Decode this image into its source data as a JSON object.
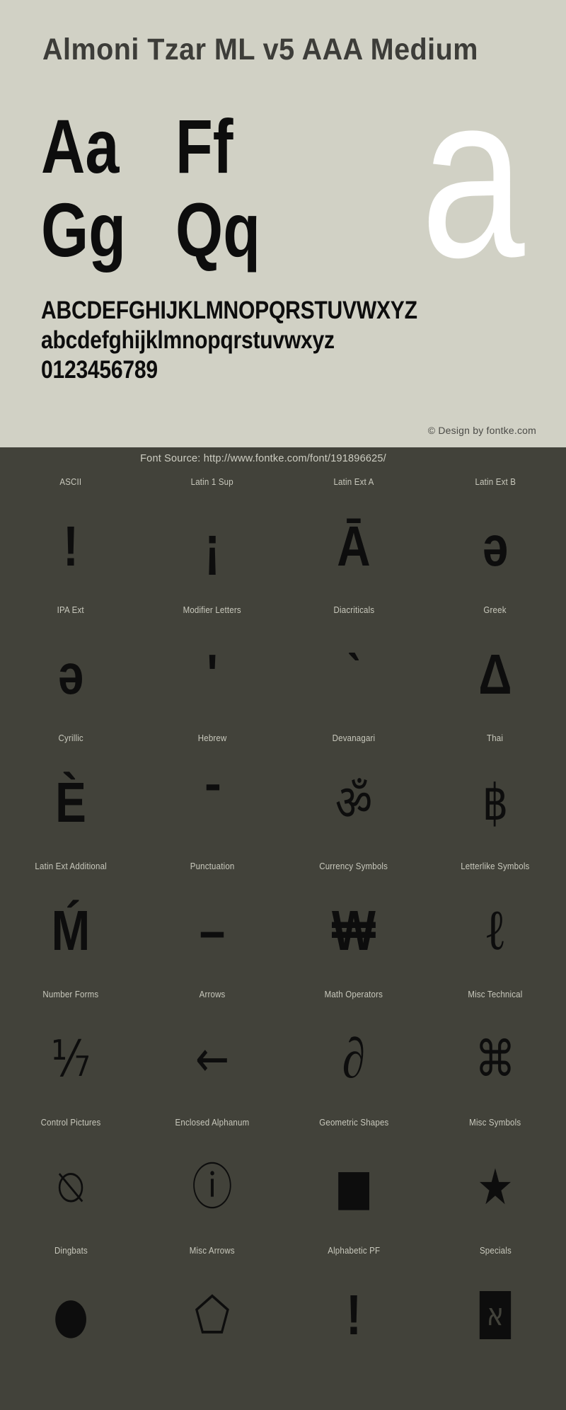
{
  "specimen": {
    "title": "Almoni Tzar ML v5 AAA Medium",
    "watermark_glyph": "a",
    "pairs": [
      [
        "Aa",
        "Ff"
      ],
      [
        "Gg",
        "Qq"
      ]
    ],
    "uppercase": "ABCDEFGHIJKLMNOPQRSTUVWXYZ",
    "lowercase": "abcdefghijklmnopqrstuvwxyz",
    "digits": "0123456789",
    "credit": "© Design by fontke.com"
  },
  "source_bar": {
    "text": "Font Source: http://www.fontke.com/font/191896625/"
  },
  "colors": {
    "specimen_bg": "#d1d1c5",
    "blocks_bg": "#42423a",
    "glyph_black": "#0d0d0d",
    "label_gray": "#c9c9bd",
    "title_gray": "#3d3d39",
    "watermark_white": "#ffffff"
  },
  "unicode_blocks": [
    [
      {
        "label": "ASCII",
        "glyph": "!",
        "style": ""
      },
      {
        "label": "Latin 1 Sup",
        "glyph": "¡",
        "style": ""
      },
      {
        "label": "Latin Ext A",
        "glyph": "Ā",
        "style": ""
      },
      {
        "label": "Latin Ext B",
        "glyph": "ə",
        "style": ""
      }
    ],
    [
      {
        "label": "IPA Ext",
        "glyph": "ə",
        "style": ""
      },
      {
        "label": "Modifier Letters",
        "glyph": "ʹ",
        "style": ""
      },
      {
        "label": "Diacriticals",
        "glyph": "ˋ",
        "style": ""
      },
      {
        "label": "Greek",
        "glyph": "Δ",
        "style": ""
      }
    ],
    [
      {
        "label": "Cyrillic",
        "glyph": "Ѐ",
        "style": ""
      },
      {
        "label": "Hebrew",
        "glyph": "־",
        "style": ""
      },
      {
        "label": "Devanagari",
        "glyph": "ॐ",
        "style": "symbolic"
      },
      {
        "label": "Thai",
        "glyph": "฿",
        "style": "symbolic"
      }
    ],
    [
      {
        "label": "Latin Ext Additional",
        "glyph": "Ḿ",
        "style": ""
      },
      {
        "label": "Punctuation",
        "glyph": "–",
        "style": ""
      },
      {
        "label": "Currency Symbols",
        "glyph": "₩",
        "style": ""
      },
      {
        "label": "Letterlike Symbols",
        "glyph": "ℓ",
        "style": "serifish"
      }
    ],
    [
      {
        "label": "Number Forms",
        "glyph": "⅐",
        "style": "symbolic"
      },
      {
        "label": "Arrows",
        "glyph": "←",
        "style": "symbolic"
      },
      {
        "label": "Math Operators",
        "glyph": "∂",
        "style": "serifish"
      },
      {
        "label": "Misc Technical",
        "glyph": "⌘",
        "style": "symbolic"
      }
    ],
    [
      {
        "label": "Control Pictures",
        "glyph": "⍉",
        "style": "symbolic"
      },
      {
        "label": "Enclosed Alphanum",
        "glyph": "ⓘ",
        "style": "symbolic"
      },
      {
        "label": "Geometric Shapes",
        "glyph": "■",
        "style": "symbolic"
      },
      {
        "label": "Misc Symbols",
        "glyph": "★",
        "style": "symbolic"
      }
    ],
    [
      {
        "label": "Dingbats",
        "glyph": "●",
        "style": "symbolic"
      },
      {
        "label": "Misc Arrows",
        "glyph": "⬠",
        "style": "symbolic"
      },
      {
        "label": "Alphabetic PF",
        "glyph": "!",
        "style": ""
      },
      {
        "label": "Specials",
        "glyph": "א",
        "style": "specials"
      }
    ]
  ]
}
